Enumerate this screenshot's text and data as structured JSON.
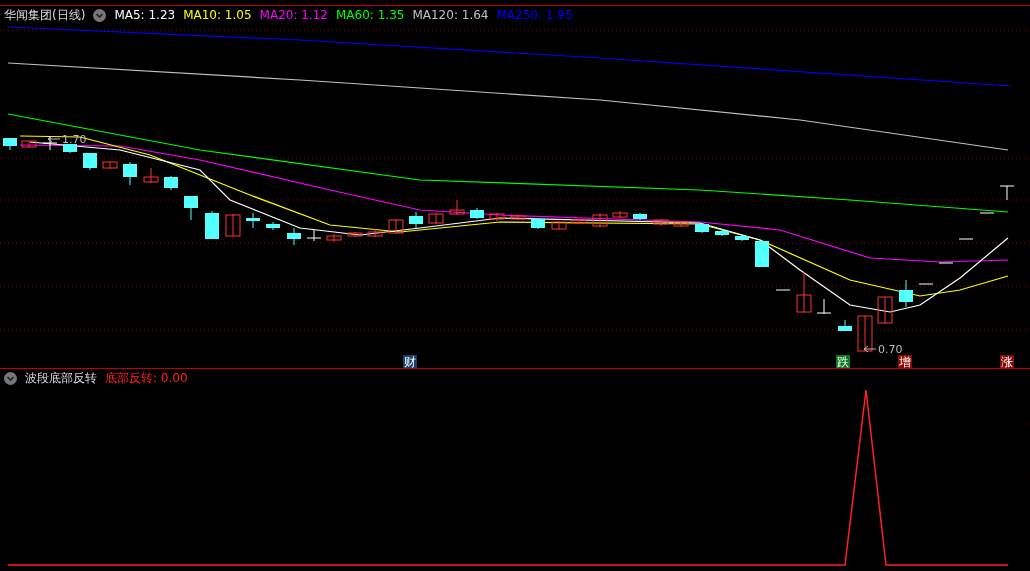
{
  "title": "华闻集团(日线)",
  "moving_averages": [
    {
      "label": "MA5: 1.23",
      "color": "#ffffff"
    },
    {
      "label": "MA10: 1.05",
      "color": "#ffff00"
    },
    {
      "label": "MA20: 1.12",
      "color": "#ff00ff"
    },
    {
      "label": "MA60: 1.35",
      "color": "#00ff00"
    },
    {
      "label": "MA120: 1.64",
      "color": "#c0c0c0"
    },
    {
      "label": "MA250: 1.95",
      "color": "#0000ff"
    }
  ],
  "price_labels": [
    {
      "text": "1.70"
    },
    {
      "text": "0.70"
    }
  ],
  "event_markers": [
    {
      "text": "财",
      "color": "#1c3f6e"
    },
    {
      "text": "跌",
      "color": "#0a7a20"
    },
    {
      "text": "增",
      "color": "#8a0a0a"
    },
    {
      "text": "涨",
      "color": "#8a0a0a"
    }
  ],
  "indicator": {
    "name": "波段底部反转",
    "series_label": "底部反转: 0.00"
  }
}
